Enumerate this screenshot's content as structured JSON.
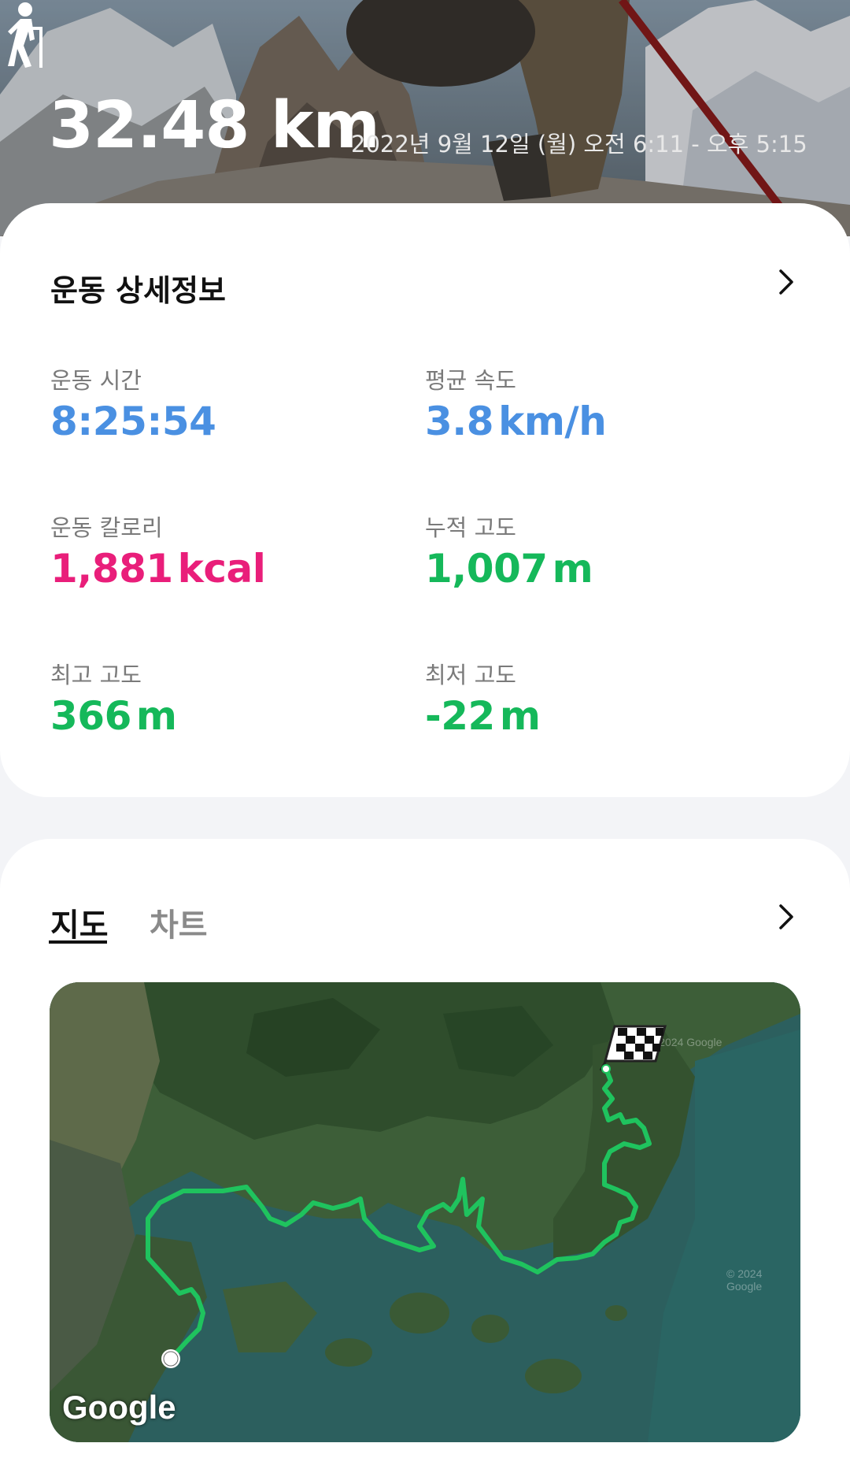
{
  "hero": {
    "distance": "32.48 km",
    "date_range": "2022년 9월 12일 (월) 오전 6:11 - 오후 5:15",
    "activity_icon": "hiking-icon"
  },
  "details": {
    "title": "운동 상세정보",
    "chevron_icon": "chevron-right-icon",
    "metrics": [
      {
        "label": "운동 시간",
        "value": "8:25:54",
        "unit": "",
        "color": "#4a90e2"
      },
      {
        "label": "평균 속도",
        "value": "3.8",
        "unit": "km/h",
        "color": "#4a90e2"
      },
      {
        "label": "운동 칼로리",
        "value": "1,881",
        "unit": "kcal",
        "color": "#e91e7a"
      },
      {
        "label": "누적 고도",
        "value": "1,007",
        "unit": "m",
        "color": "#15b85a"
      },
      {
        "label": "최고 고도",
        "value": "366",
        "unit": "m",
        "color": "#15b85a"
      },
      {
        "label": "최저 고도",
        "value": "-22",
        "unit": "m",
        "color": "#15b85a"
      }
    ]
  },
  "map_section": {
    "tabs": [
      {
        "label": "지도",
        "active": true
      },
      {
        "label": "차트",
        "active": false
      }
    ],
    "chevron_icon": "chevron-right-icon",
    "map": {
      "logo": "Google",
      "watermark": "© 2024 Google",
      "route_color": "#1fc35e",
      "start_marker": "start-dot-icon",
      "finish_marker": "checkered-flag-icon"
    }
  }
}
